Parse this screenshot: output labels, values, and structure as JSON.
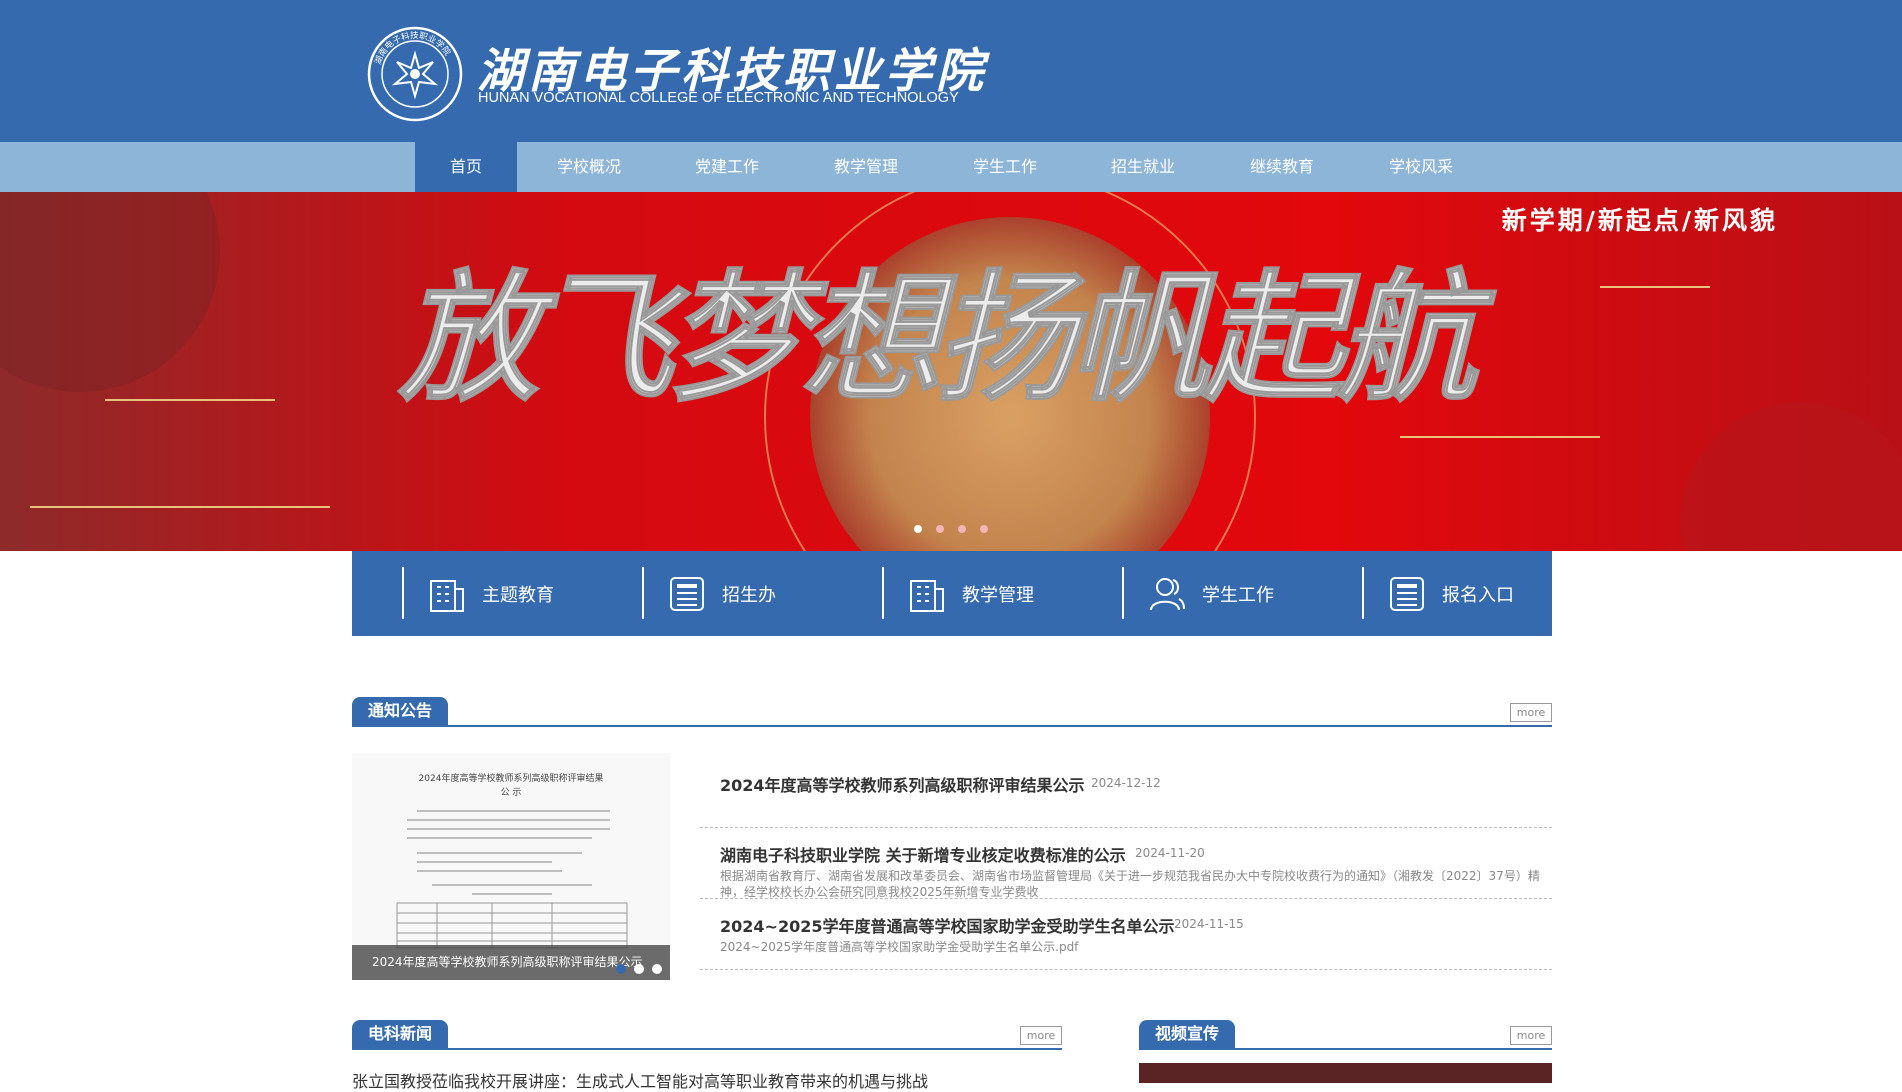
{
  "header": {
    "seal_text": "湖南电子科技职业学院",
    "name_cn": "湖南电子科技职业学院",
    "name_en": "HUNAN VOCATIONAL COLLEGE OF ELECTRONIC AND TECHNOLOGY"
  },
  "nav": {
    "items": [
      {
        "label": "首页",
        "active": true
      },
      {
        "label": "学校概况"
      },
      {
        "label": "党建工作"
      },
      {
        "label": "教学管理"
      },
      {
        "label": "学生工作"
      },
      {
        "label": "招生就业"
      },
      {
        "label": "继续教育"
      },
      {
        "label": "学校风采"
      }
    ]
  },
  "banner": {
    "slogan_small": "新学期/新起点/新风貌",
    "slogan_big": "放飞梦想扬帆起航",
    "slide_count": 4,
    "active_slide": 1
  },
  "quick_links": [
    {
      "label": "主题教育",
      "icon": "building-icon"
    },
    {
      "label": "招生办",
      "icon": "newspaper-icon"
    },
    {
      "label": "教学管理",
      "icon": "building-icon"
    },
    {
      "label": "学生工作",
      "icon": "users-icon"
    },
    {
      "label": "报名入口",
      "icon": "newspaper-icon"
    }
  ],
  "notices": {
    "title": "通知公告",
    "more": "more",
    "image_caption": "2024年度高等学校教师系列高级职称评审结果公示",
    "doc_title": "2024年度高等学校教师系列高级职称评审结果",
    "doc_sub": "公 示",
    "items": [
      {
        "title": "2024年度高等学校教师系列高级职称评审结果公示",
        "date": "2024-12-12",
        "summary": ""
      },
      {
        "title": "湖南电子科技职业学院 关于新增专业核定收费标准的公示",
        "date": "2024-11-20",
        "summary": "根据湖南省教育厅、湖南省发展和改革委员会、湖南省市场监督管理局《关于进一步规范我省民办大中专院校收费行为的通知》（湘教发〔2022〕37号）精神，经学校校长办公会研究同意我校2025年新增专业学费收"
      },
      {
        "title": "2024~2025学年度普通高等学校国家助学金受助学生名单公示",
        "date": "2024-11-15",
        "summary": "2024~2025学年度普通高等学校国家助学金受助学生名单公示.pdf"
      }
    ]
  },
  "news": {
    "title": "电科新闻",
    "more": "more",
    "first_item": "张立国教授莅临我校开展讲座：生成式人工智能对高等职业教育带来的机遇与挑战"
  },
  "video": {
    "title": "视频宣传",
    "more": "more"
  },
  "colors": {
    "primary": "#356aae",
    "nav_bg": "#8db5d8",
    "banner_red": "#c40d12",
    "gold": "#c8965a"
  }
}
